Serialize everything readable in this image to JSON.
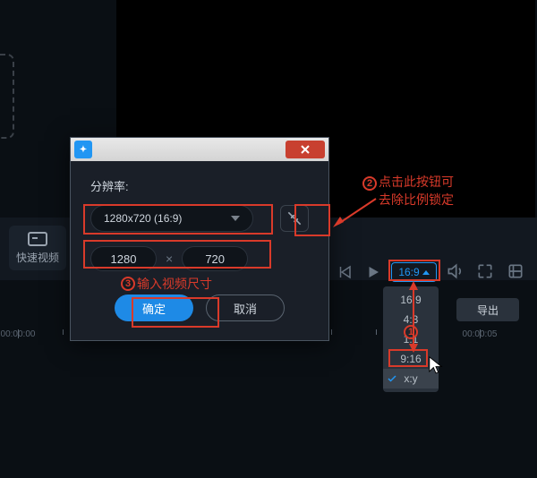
{
  "sidebar": {
    "quick_label": "快速视频"
  },
  "playback": {
    "aspect_label": "16:9"
  },
  "export_label": "导出",
  "aspect_menu": {
    "items": [
      "16:9",
      "4:3",
      "1:1",
      "9:16",
      "x:y"
    ],
    "selected": "x:y"
  },
  "ruler": {
    "labels": [
      "00:00:00",
      "00:00:05"
    ]
  },
  "dialog": {
    "resolution_label": "分辨率:",
    "preset": "1280x720 (16:9)",
    "width": "1280",
    "height": "720",
    "mult": "×",
    "ok": "确定",
    "cancel": "取消"
  },
  "annotations": {
    "a2_line1": "点击此按钮可",
    "a2_line2": "去除比例锁定",
    "a3": "输入视频尺寸",
    "n1": "1",
    "n2": "2",
    "n3": "3"
  }
}
